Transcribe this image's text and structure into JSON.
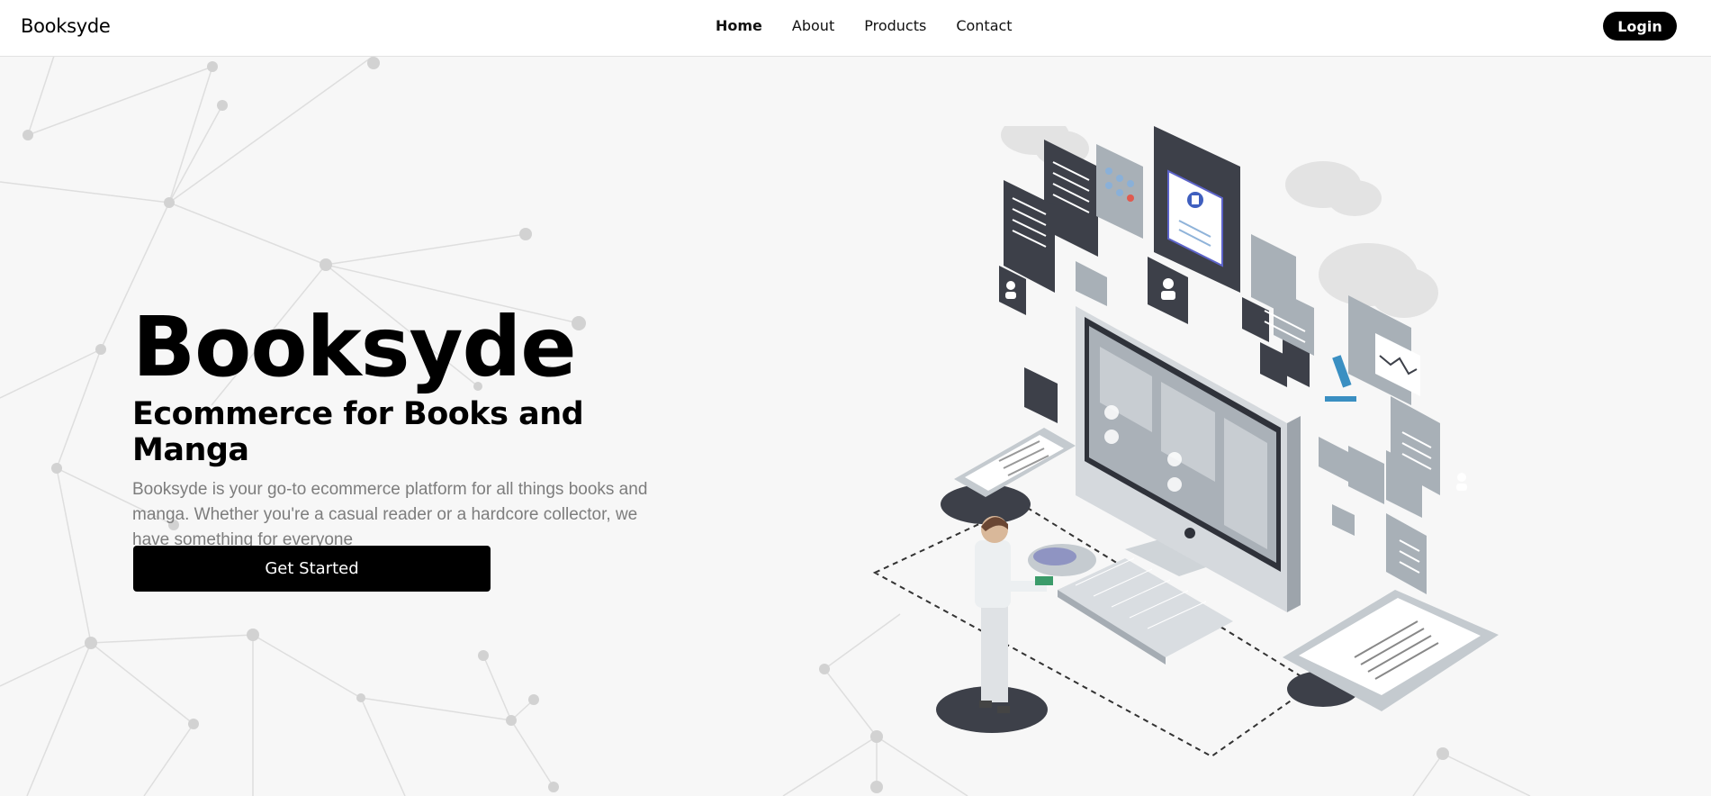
{
  "header": {
    "brand": "Booksyde",
    "nav": [
      "Home",
      "About",
      "Products",
      "Contact"
    ],
    "active_nav": "Home",
    "login_label": "Login"
  },
  "hero": {
    "title": "Booksyde",
    "subtitle": "Ecommerce for Books and Manga",
    "description": "Booksyde is your go-to ecommerce platform for all things books and manga. Whether you're a casual reader or a hardcore collector, we have something for everyone",
    "cta_label": "Get Started"
  },
  "colors": {
    "primary": "#000000",
    "background": "#f7f7f7",
    "muted_text": "#7d7d7d",
    "illustration_dark": "#3d4049",
    "illustration_light": "#b9c1c8"
  },
  "icons": [
    "user-icon",
    "medical-cross-icon",
    "microscope-icon",
    "chart-icon",
    "cloud-icon"
  ]
}
